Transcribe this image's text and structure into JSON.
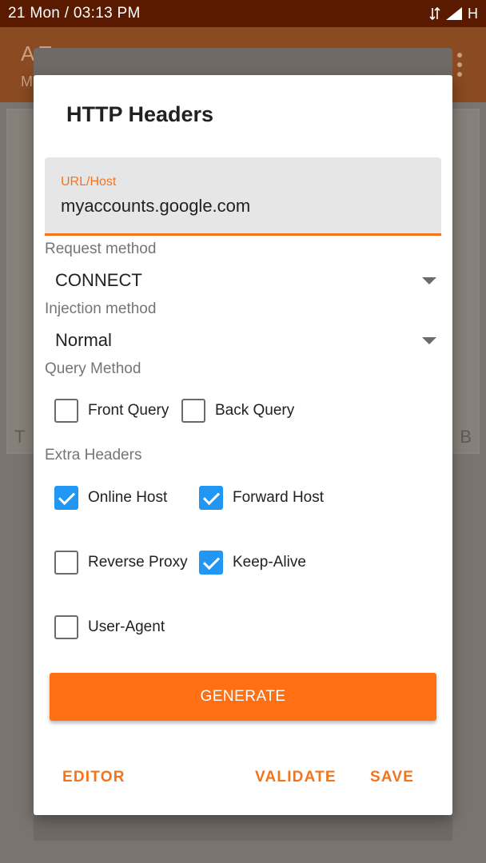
{
  "status_bar": {
    "time": "21 Mon   /   03:13 PM",
    "network": "H"
  },
  "background_app": {
    "title_fragment": "A       T",
    "subtitle_fragment": "M",
    "card_left_fragment": "T",
    "card_right_fragment": "B"
  },
  "dialog": {
    "title": "HTTP Headers",
    "url_field": {
      "label": "URL/Host",
      "value": "myaccounts.google.com"
    },
    "request_method": {
      "label": "Request method",
      "selected": "CONNECT"
    },
    "injection_method": {
      "label": "Injection method",
      "selected": "Normal"
    },
    "query_method": {
      "label": "Query Method",
      "options": [
        {
          "label": "Front Query",
          "checked": false
        },
        {
          "label": "Back Query",
          "checked": false
        }
      ]
    },
    "extra_headers": {
      "label": "Extra Headers",
      "options": [
        {
          "label": "Online Host",
          "checked": true
        },
        {
          "label": "Forward Host",
          "checked": true
        },
        {
          "label": "Reverse Proxy",
          "checked": false
        },
        {
          "label": "Keep-Alive",
          "checked": true
        },
        {
          "label": "User-Agent",
          "checked": false
        }
      ]
    },
    "generate_label": "GENERATE",
    "actions": {
      "editor": "EDITOR",
      "validate": "VALIDATE",
      "save": "SAVE"
    }
  },
  "colors": {
    "accent": "#f5741a",
    "button": "#ff6f14",
    "checkbox_checked": "#2196f3",
    "status_bar": "#5a1a00"
  }
}
